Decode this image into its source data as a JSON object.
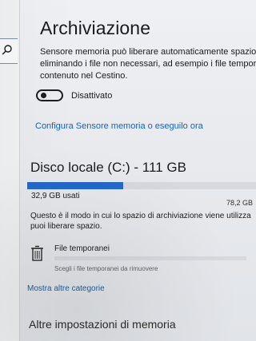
{
  "sidebar": {
    "search_icon": "search-icon"
  },
  "storage_page": {
    "title": "Archiviazione",
    "description_lines": [
      "Sensore memoria può liberare automaticamente spazio su",
      "eliminando i file non necessari, ad esempio i file temporane",
      "contenuto nel Cestino."
    ],
    "toggle": {
      "state": "off",
      "label": "Disattivato"
    },
    "configure_link": "Configura Sensore memoria o eseguilo ora",
    "disk": {
      "title": "Disco locale (C:) - 111 GB",
      "used_label": "32,9 GB usati",
      "total_label": "78,2 GB",
      "used_fraction": 0.42,
      "bar_color": "#2469ca"
    },
    "storage_desc_lines": [
      "Questo è il modo in cui lo spazio di archiviazione viene utilizza",
      "puoi liberare spazio."
    ],
    "temporary_files": {
      "title": "File temporanei",
      "subtitle": "Scegli i file temporanei da rimuovere",
      "progress_fraction": 0.0,
      "icon": "trash-icon"
    },
    "show_more": "Mostra altre categorie",
    "memory_settings_title": "Altre impostazioni di memoria"
  },
  "colors": {
    "link": "#1762b4",
    "accent": "#2469ca"
  }
}
